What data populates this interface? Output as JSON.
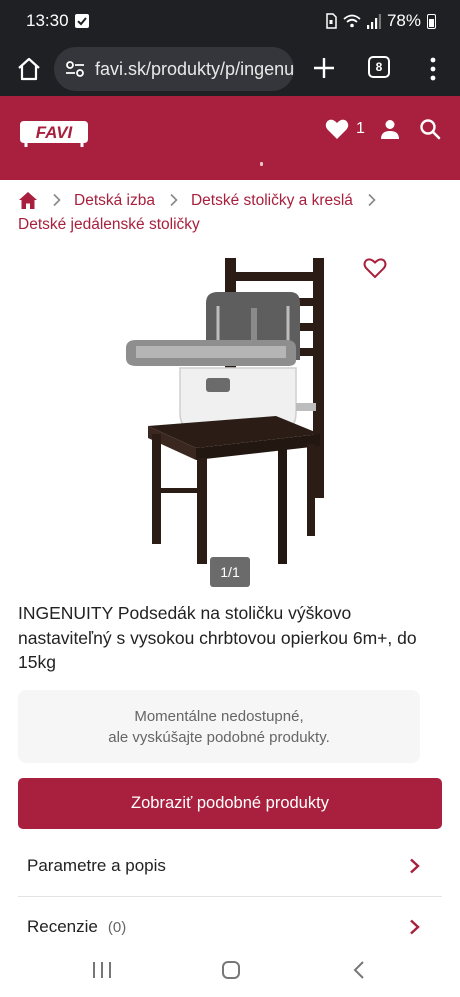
{
  "status_bar": {
    "time": "13:30",
    "battery": "78%"
  },
  "browser": {
    "url": "favi.sk/produkty/p/ingenuity",
    "tab_count": "8"
  },
  "header": {
    "logo_text": "FAVI",
    "wishlist_count": "1",
    "brand_color": "#a8203d"
  },
  "breadcrumb": {
    "items": [
      "Detská izba",
      "Detské stoličky a kreslá",
      "Detské jedálenské stoličky"
    ]
  },
  "gallery": {
    "counter": "1/1"
  },
  "product": {
    "title": "INGENUITY Podsedák na stoličku výškovo nastaviteľný s vysokou chrbtovou opierkou 6m+, do 15kg"
  },
  "availability": {
    "line1": "Momentálne nedostupné,",
    "line2": "ale vyskúšajte podobné produkty."
  },
  "cta": {
    "label": "Zobraziť podobné produkty"
  },
  "sections": [
    {
      "label": "Parametre a popis",
      "count": ""
    },
    {
      "label": "Recenzie",
      "count": "(0)"
    }
  ],
  "icons": {
    "home": "home-icon",
    "site_settings": "tune-icon",
    "new_tab": "plus-icon",
    "tabs": "tab-switcher-icon",
    "menu": "more-vert-icon",
    "wishlist": "heart-icon",
    "user": "user-icon",
    "search": "search-icon",
    "breadcrumb_home": "house-icon",
    "chevron": "chevron-right-icon"
  }
}
